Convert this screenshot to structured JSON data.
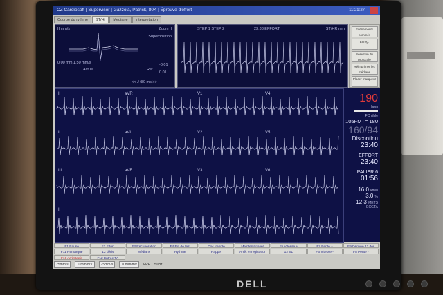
{
  "window": {
    "title": "CZ Cardiosoft | Supervisor | Gazzola, Patrick, 80K | Épreuve d'effort",
    "clock": "11:21:27"
  },
  "tabs": [
    "Courbe du rythme",
    "ST/Hr",
    "Mediane",
    "Interpretation"
  ],
  "panel1": {
    "left_top": "II  mm/s",
    "right_top": "Zoom II",
    "sub": "Superposition",
    "bottom_left": "0.00 mm\n1.50 mm/s",
    "actual": "Actuel",
    "ref": "Ref",
    "v1": "-0.01",
    "v2": "0.01",
    "footer": "<< J+80 ms >>"
  },
  "panel2": {
    "left": "STEP 1 STEP 2",
    "center": "23:38 EFFORT",
    "right": "ST/HR mm"
  },
  "side_buttons": [
    "Événements nommés",
    "Enreg.",
    "Sélection du protocole",
    "Réimprimer les médians",
    "Placer marqueur"
  ],
  "leads": [
    "I",
    "aVR",
    "V1",
    "V4",
    "II",
    "aVL",
    "V2",
    "V5",
    "III",
    "aVF",
    "V3",
    "V6",
    "II"
  ],
  "vitals": {
    "hr": "190",
    "hr_unit": "bpm",
    "fc_label": "FC cible",
    "fmt": "105FMT= 180",
    "bp": "160/94",
    "disc_label": "Discontinu",
    "disc_time": "23:40",
    "effort_label": "EFFORT",
    "effort_time": "23:40",
    "palier_label": "PALIER 6",
    "palier_time": "01:56",
    "speed": "16.0",
    "speed_unit": "km/h",
    "grade": "3.0",
    "grade_unit": "%",
    "mets": "12.3",
    "mets_unit": "METS",
    "footer": "ECGTA"
  },
  "fkeys": [
    "F1 Pause",
    "F2 Effort",
    "F3 Récupération",
    "F4 Fin de test",
    "Doc. rapide",
    "Maintenir palier",
    "F5 Vitesse +",
    "F7 Pente +",
    "F9 Dérivée 12 dér",
    "F11 Remarque",
    "12 dériv",
    "Médians",
    "Rythme",
    "Rappel",
    "Arrêt enregistreur",
    "12 SL",
    "F6 Vitesse -",
    "F8 Pente -",
    "F10 Arrêt tapis",
    "F12 Entrée TA"
  ],
  "bottom": {
    "s1": "25mm/s",
    "s2": "10mm/mV",
    "s3": "25mm/s",
    "s4": "10mm/mV",
    "filter": "FRF",
    "hz": "50Hz"
  },
  "brand": "DELL"
}
